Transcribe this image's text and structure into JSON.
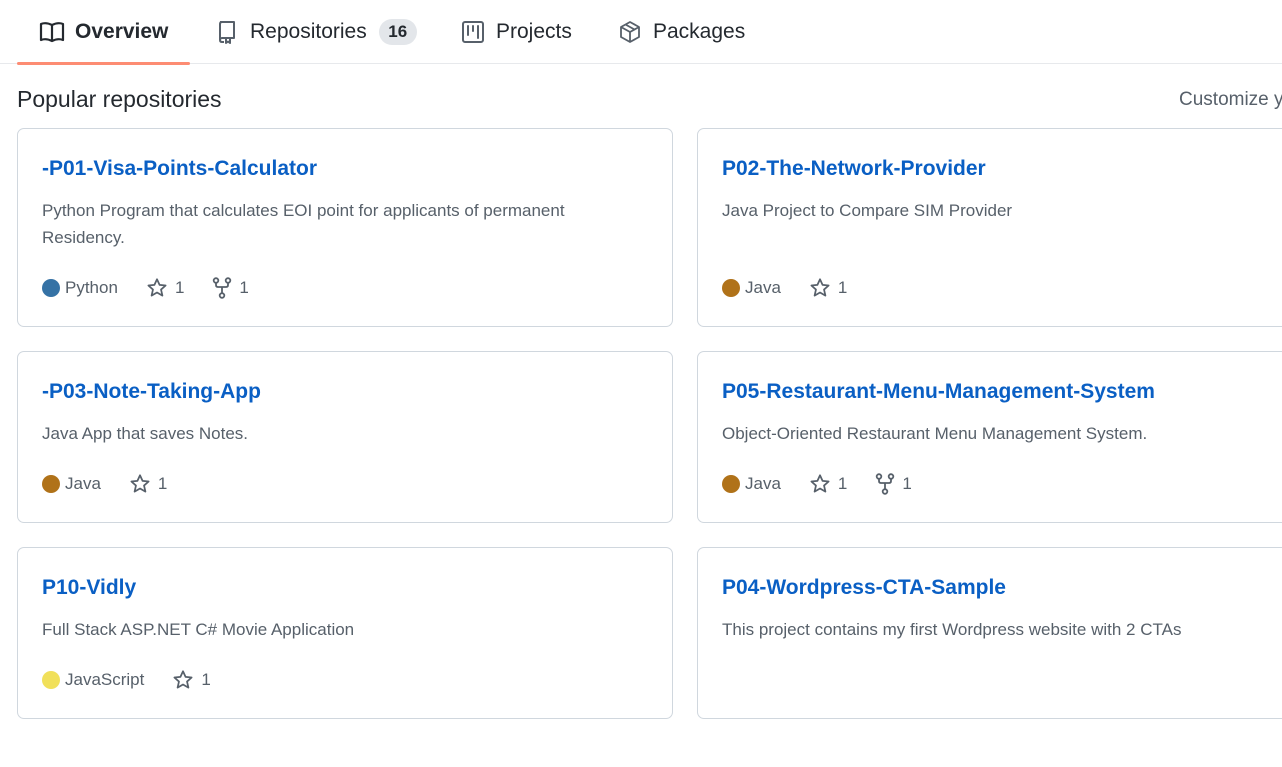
{
  "tabs": [
    {
      "label": "Overview",
      "icon": "book-icon",
      "active": true
    },
    {
      "label": "Repositories",
      "icon": "repo-icon",
      "count": "16"
    },
    {
      "label": "Projects",
      "icon": "project-icon"
    },
    {
      "label": "Packages",
      "icon": "package-icon"
    }
  ],
  "section_title": "Popular repositories",
  "customize_label": "Customize y",
  "colors": {
    "link": "#0a5fc4",
    "tab_underline": "#fd8c73",
    "python": "#3572a5",
    "java": "#b07219",
    "javascript": "#f1e05a"
  },
  "repos": [
    {
      "name": "-P01-Visa-Points-Calculator",
      "description": "Python Program that calculates EOI point for applicants of permanent Residency.",
      "language": "Python",
      "stars": "1",
      "forks": "1"
    },
    {
      "name": "P02-The-Network-Provider",
      "description": "Java Project to Compare SIM Provider",
      "language": "Java",
      "stars": "1"
    },
    {
      "name": "-P03-Note-Taking-App",
      "description": "Java App that saves Notes.",
      "language": "Java",
      "stars": "1"
    },
    {
      "name": "P05-Restaurant-Menu-Management-System",
      "description": "Object-Oriented Restaurant Menu Management System.",
      "language": "Java",
      "stars": "1",
      "forks": "1"
    },
    {
      "name": "P10-Vidly",
      "description": "Full Stack ASP.NET C# Movie Application",
      "language": "JavaScript",
      "stars": "1"
    },
    {
      "name": "P04-Wordpress-CTA-Sample",
      "description": "This project contains my first Wordpress website with 2 CTAs"
    }
  ]
}
